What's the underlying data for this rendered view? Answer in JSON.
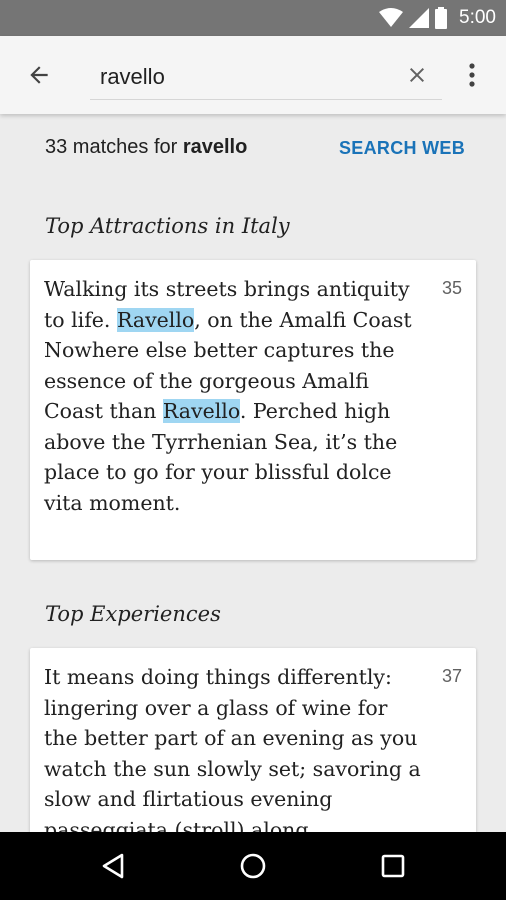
{
  "status_bar": {
    "time": "5:00",
    "icons": [
      "wifi-icon",
      "signal-icon",
      "battery-icon"
    ]
  },
  "toolbar": {
    "search_value": "ravello",
    "icons": {
      "back": "arrow-back-icon",
      "clear": "close-icon",
      "more": "more-vert-icon"
    }
  },
  "results": {
    "count_prefix": "33 matches for ",
    "query": "ravello",
    "search_web_label": "SEARCH WEB"
  },
  "sections": [
    {
      "title": "Top Attractions in Italy",
      "page": "35",
      "text_parts": [
        "Walking its streets brings antiquity to life. ",
        "Ravello",
        ", on the Amalfi Coast Nowhere else better captures the essence of the gorgeous Amalfi Coast than ",
        "Ravello",
        ". Perched high above the Tyrrhenian Sea, it’s the place to go for your blissful dolce vita moment."
      ]
    },
    {
      "title": "Top Experiences",
      "page": "37",
      "text": "It means doing things differently: lingering over a glass of wine for the better part of an evening as you watch the sun slowly set; savoring a slow and flirtatious evening passeggiata (stroll) along"
    }
  ],
  "nav_bar": {
    "icons": [
      "back-triangle-icon",
      "home-circle-icon",
      "recents-square-icon"
    ]
  },
  "colors": {
    "accent": "#1a73b8",
    "highlight": "#9fd6f2",
    "status_bar": "#757575",
    "toolbar": "#f5f5f5",
    "background": "#ececec"
  }
}
